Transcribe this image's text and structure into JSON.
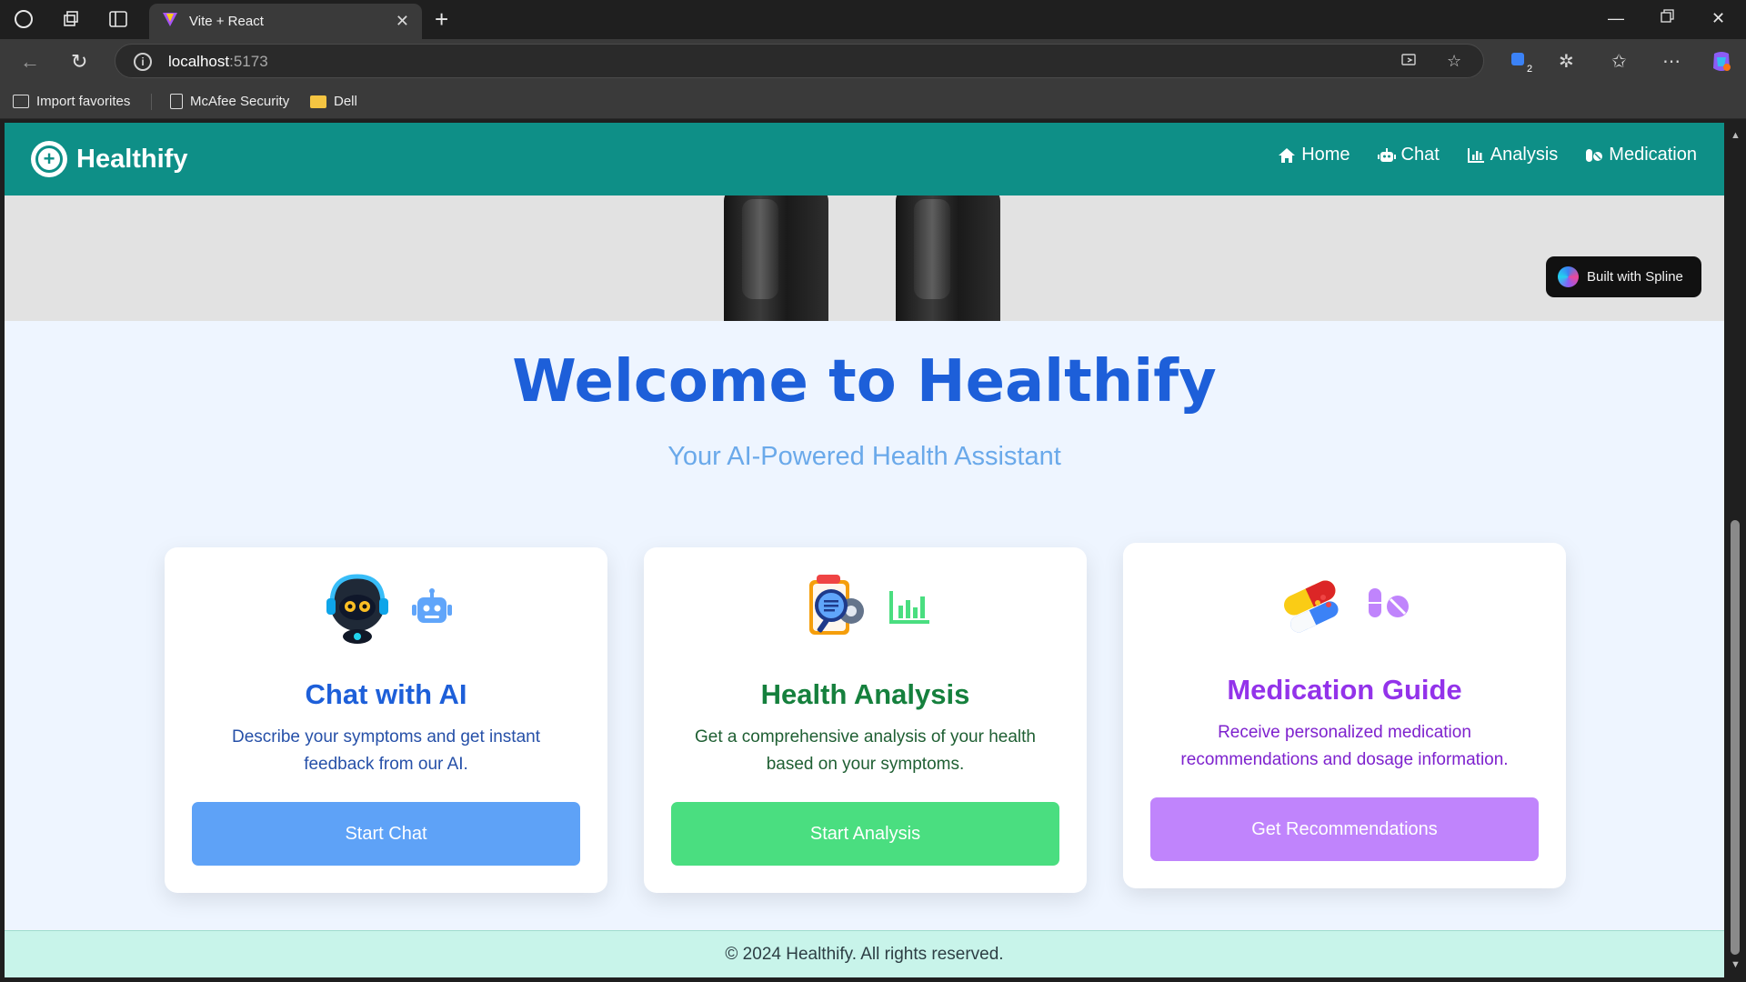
{
  "browser": {
    "tab_title": "Vite + React",
    "url_host": "localhost",
    "url_port": ":5173",
    "extension_badge": "2",
    "bookmarks": [
      "Import favorites",
      "McAfee Security",
      "Dell"
    ]
  },
  "navbar": {
    "brand": "Healthify",
    "links": [
      {
        "label": "Home",
        "icon": "home-icon"
      },
      {
        "label": "Chat",
        "icon": "robot-icon"
      },
      {
        "label": "Analysis",
        "icon": "chart-icon"
      },
      {
        "label": "Medication",
        "icon": "pills-icon"
      }
    ]
  },
  "hero": {
    "spline_badge": "Built with Spline"
  },
  "main": {
    "title": "Welcome to Healthify",
    "subtitle": "Your AI-Powered Health Assistant"
  },
  "cards": [
    {
      "title": "Chat with AI",
      "description": "Describe your symptoms and get instant feedback from our AI.",
      "button": "Start Chat",
      "title_color": "#1d5fd9",
      "desc_color": "#2650a8",
      "button_color": "#5ea2f7",
      "icons": [
        "ai-robot-mascot-icon",
        "robot-icon"
      ]
    },
    {
      "title": "Health Analysis",
      "description": "Get a comprehensive analysis of your health based on your symptoms.",
      "button": "Start Analysis",
      "title_color": "#15803d",
      "desc_color": "#1f5f33",
      "button_color": "#4ade80",
      "icons": [
        "analysis-magnifier-icon",
        "chart-icon"
      ]
    },
    {
      "title": "Medication Guide",
      "description": "Receive personalized medication recommendations and dosage information.",
      "button": "Get Recommendations",
      "title_color": "#9333ea",
      "desc_color": "#7e22ce",
      "button_color": "#c084fc",
      "icons": [
        "capsules-icon",
        "pills-icon"
      ]
    }
  ],
  "footer": {
    "text": "© 2024 Healthify. All rights reserved."
  }
}
